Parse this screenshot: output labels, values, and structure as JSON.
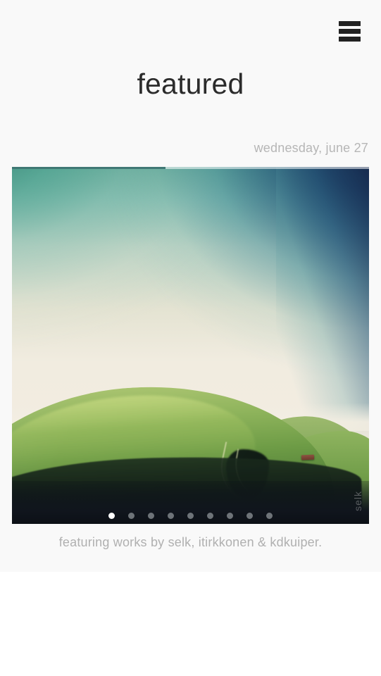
{
  "header": {
    "menu_icon": "hamburger-menu-icon",
    "menu_label": "Menu"
  },
  "page": {
    "title": "featured",
    "date": "wednesday, june 27",
    "caption": "featuring works by selk, itirkkonen & kdkuiper."
  },
  "media": {
    "watermark": "selk",
    "progress_percent": 43,
    "alt": "rolling green hills under a teal and cream sky with a small barn"
  },
  "carousel": {
    "total_slides": 9,
    "active_index": 0,
    "dots": [
      {
        "index": 1,
        "active": true
      },
      {
        "index": 2,
        "active": false
      },
      {
        "index": 3,
        "active": false
      },
      {
        "index": 4,
        "active": false
      },
      {
        "index": 5,
        "active": false
      },
      {
        "index": 6,
        "active": false
      },
      {
        "index": 7,
        "active": false
      },
      {
        "index": 8,
        "active": false
      },
      {
        "index": 9,
        "active": false
      }
    ]
  },
  "colors": {
    "page_background": "#ffffff",
    "card_background": "#f9f9f9",
    "title_text": "#2b2b2b",
    "muted_text": "#b6b6b6",
    "menu_bar": "#222222",
    "dot_active": "#ffffff",
    "progress_fill": "#35706c"
  }
}
